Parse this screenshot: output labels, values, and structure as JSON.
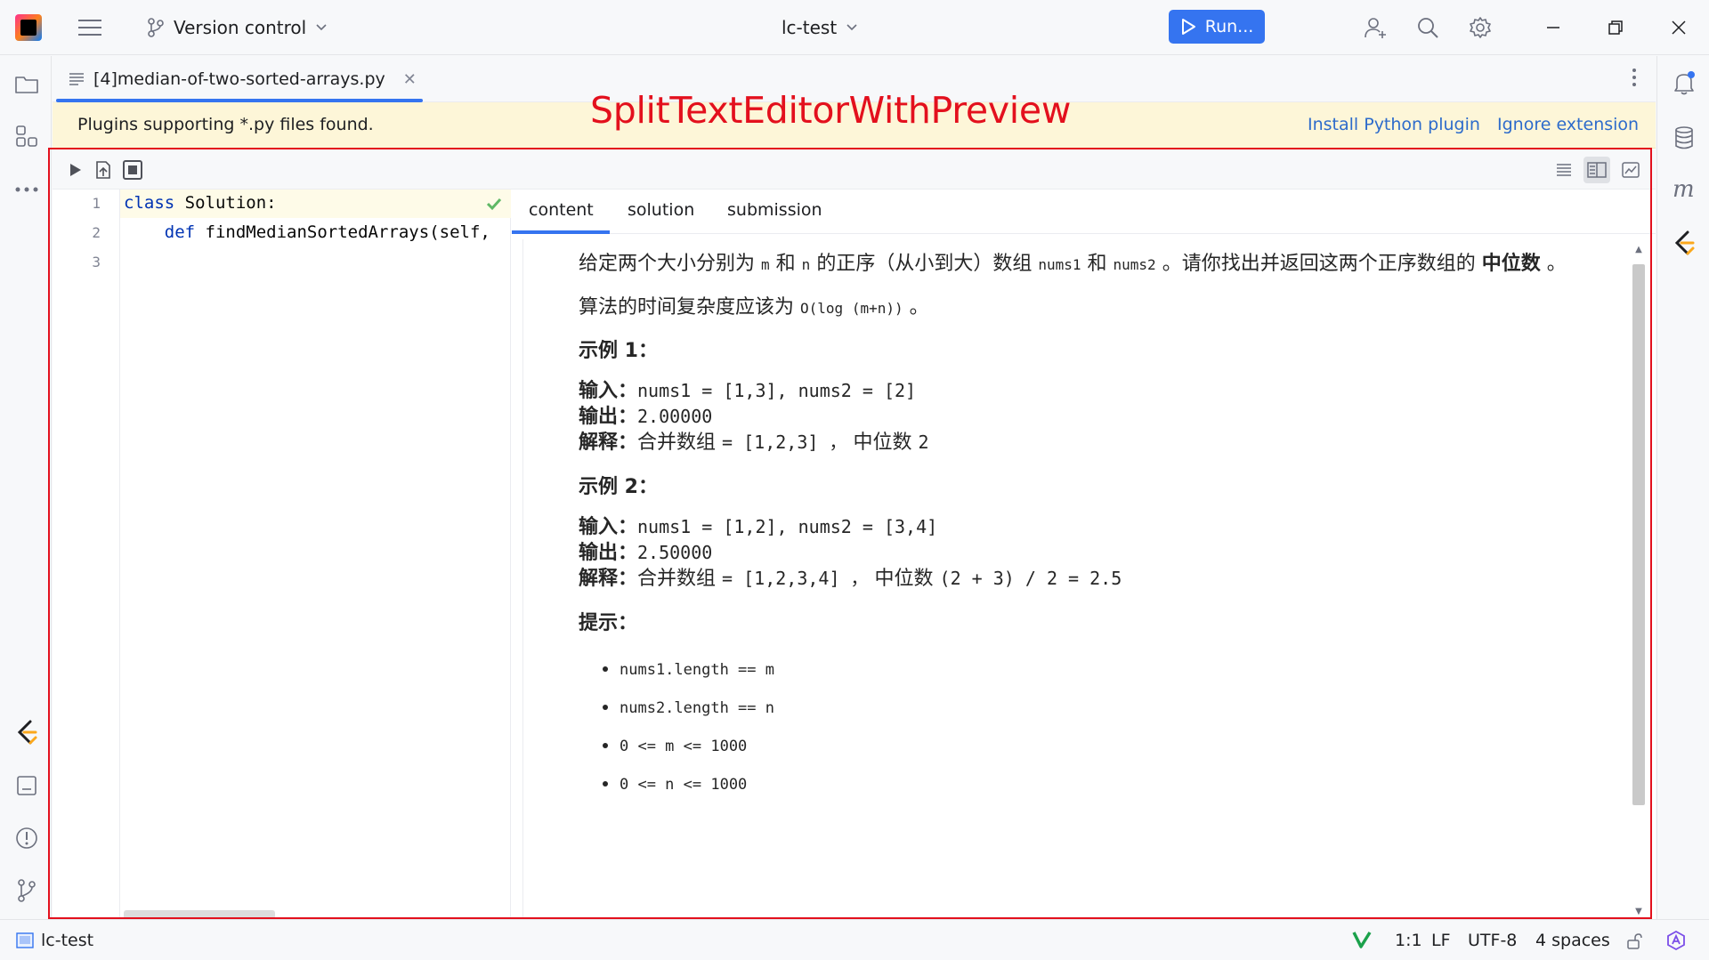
{
  "titlebar": {
    "version_control": "Version control",
    "project_name": "lc-test",
    "run_label": "Run..."
  },
  "editor": {
    "tab_label": "[4]median-of-two-sorted-arrays.py",
    "banner_text": "Plugins supporting *.py files found.",
    "install_plugin": "Install Python plugin",
    "ignore_extension": "Ignore extension",
    "annotation": "SplitTextEditorWithPreview",
    "line_numbers": [
      "1",
      "2",
      "3"
    ],
    "code": {
      "line1_kw": "class",
      "line1_rest": " Solution:",
      "line2_kw": "def",
      "line2_rest": " findMedianSortedArrays(self,"
    }
  },
  "preview": {
    "tabs": [
      "content",
      "solution",
      "submission"
    ],
    "intro_1": "给定两个大小分别为",
    "var_m": "m",
    "and": "和",
    "var_n": "n",
    "intro_2": "的正序（从小到大）数组",
    "nums1": "nums1",
    "nums2": "nums2",
    "intro_3": "。请你找出并返回这两个正序数组的",
    "median": "中位数",
    "period": "。",
    "complexity_prefix": "算法的时间复杂度应该为",
    "complexity": "O(log (m+n))",
    "example1_title": "示例 1：",
    "input_label": "输入：",
    "output_label": "输出：",
    "explain_label": "解释：",
    "ex1_input": "nums1 = [1,3], nums2 = [2]",
    "ex1_output": "2.00000",
    "ex1_explain_text": "合并数组",
    "ex1_explain_code": "= [1,2,3] ，",
    "ex1_explain_text2": "中位数",
    "ex1_explain_code2": "2",
    "example2_title": "示例 2：",
    "ex2_input": "nums1 = [1,2], nums2 = [3,4]",
    "ex2_output": "2.50000",
    "ex2_explain_text": "合并数组",
    "ex2_explain_code": "= [1,2,3,4] ，",
    "ex2_explain_text2": "中位数",
    "ex2_explain_code2": "(2 + 3) / 2 = 2.5",
    "hints_title": "提示：",
    "hints": [
      "nums1.length == m",
      "nums2.length == n",
      "0 <= m <= 1000",
      "0 <= n <= 1000"
    ]
  },
  "statusbar": {
    "project": "lc-test",
    "position": "1:1",
    "line_sep": "LF",
    "encoding": "UTF-8",
    "indent": "4 spaces"
  },
  "colors": {
    "accent": "#3574f0",
    "annotation_red": "#e3101d",
    "banner_bg": "#fdf6d8",
    "link": "#2d6bcb",
    "keyword": "#0033b3"
  }
}
